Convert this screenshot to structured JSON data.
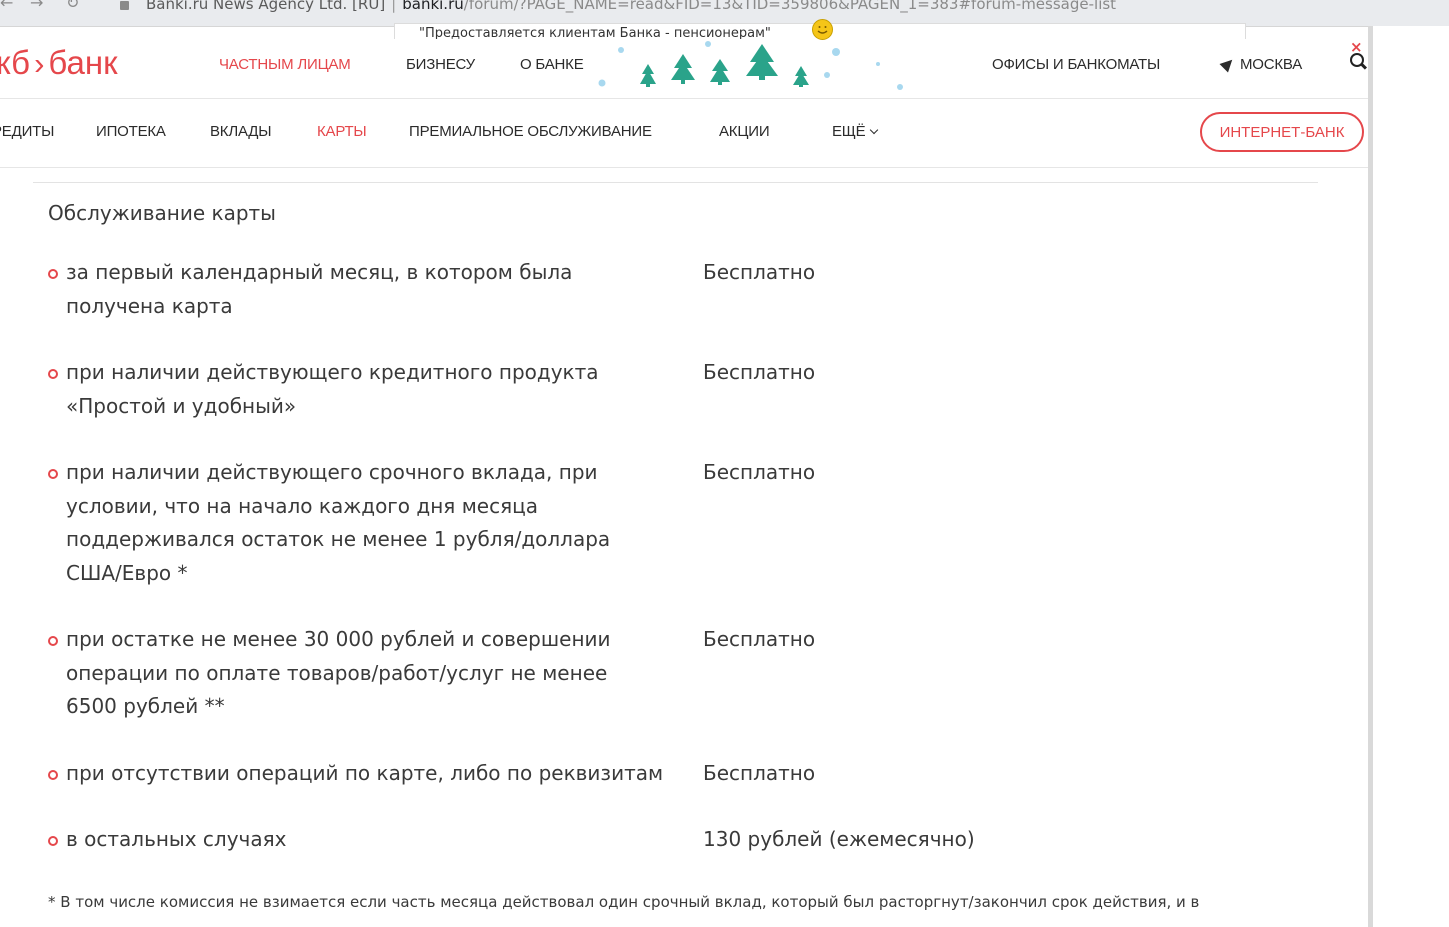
{
  "browser": {
    "tab_title": "Banki.ru News Agency Ltd. [RU]",
    "url_host": "banki.ru",
    "url_path": "/forum/?PAGE_NAME=read&FID=13&TID=359806&PAGEN_1=383#forum-message-list",
    "bubble_text": "\"Предоставляется клиентам Банка - пенсионерам\""
  },
  "header": {
    "logo_left": "кб",
    "logo_chevron": "›",
    "logo_right": "банк",
    "nav": [
      "ЧАСТНЫМ ЛИЦАМ",
      "БИЗНЕСУ",
      "О БАНКЕ"
    ],
    "offices": "ОФИСЫ И БАНКОМАТЫ",
    "city": "МОСКВА",
    "close_symbol": "×"
  },
  "subnav": {
    "items": [
      "РЕДИТЫ",
      "ИПОТЕКА",
      "ВКЛАДЫ",
      "КАРТЫ",
      "ПРЕМИАЛЬНОЕ ОБСЛУЖИВАНИЕ",
      "АКЦИИ",
      "ЕЩЁ"
    ],
    "internet_bank": "ИНТЕРНЕТ-БАНК"
  },
  "content": {
    "title": "Обслуживание карты",
    "rows": [
      {
        "lines": [
          "за первый календарный месяц, в котором была",
          "получена карта"
        ],
        "price": "Бесплатно"
      },
      {
        "lines": [
          "при наличии действующего кредитного продукта",
          "«Простой и удобный»"
        ],
        "price": "Бесплатно"
      },
      {
        "lines": [
          "при наличии действующего срочного вклада, при",
          "условии, что на начало каждого дня месяца",
          "поддерживался остаток не менее 1 рубля/доллара",
          "США/Евро *"
        ],
        "price": "Бесплатно"
      },
      {
        "lines": [
          "при остатке не менее 30 000 рублей и совершении",
          "операции по оплате товаров/работ/услуг не менее",
          "6500 рублей **"
        ],
        "price": "Бесплатно"
      },
      {
        "lines": [
          "при отсутствии операций по карте, либо по реквизитам"
        ],
        "price": "Бесплатно"
      },
      {
        "lines": [
          "в остальных случаях"
        ],
        "price": "130 рублей (ежемесячно)"
      }
    ],
    "footnote": "* В том числе комиссия не взимается если часть месяца действовал один срочный вклад, который был расторгнут/закончил срок действия, и в"
  },
  "colors": {
    "accent": "#e5474b",
    "tree": "#2aa38a",
    "text": "#3a3a3a"
  }
}
